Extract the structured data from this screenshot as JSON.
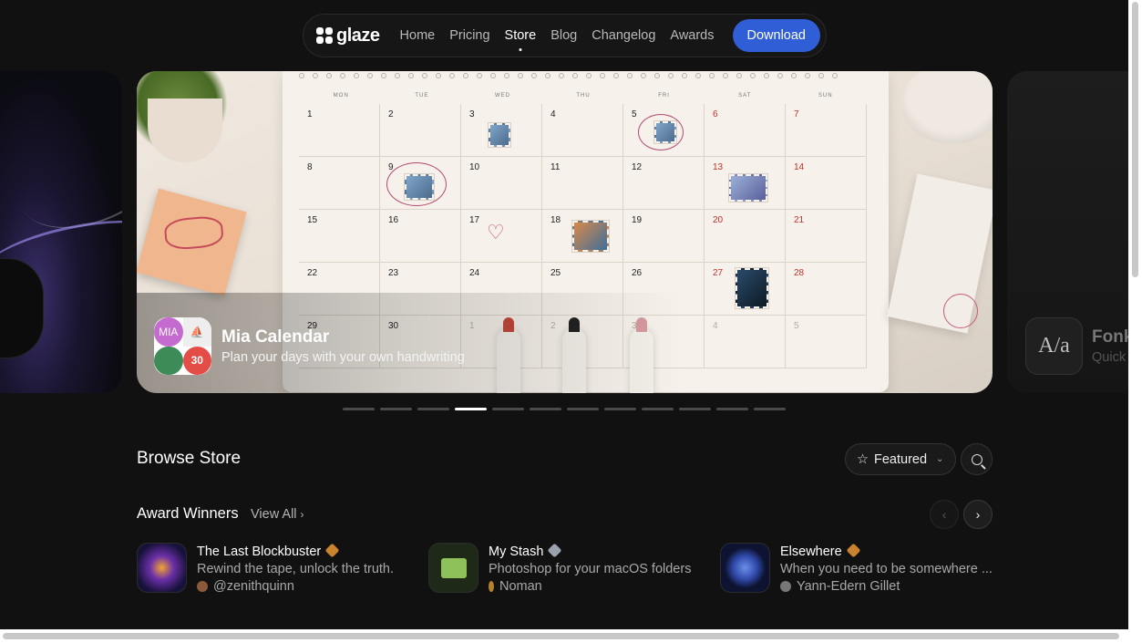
{
  "nav": {
    "logo_text": "glaze",
    "links": [
      "Home",
      "Pricing",
      "Store",
      "Blog",
      "Changelog",
      "Awards"
    ],
    "active_link": "Store",
    "download_label": "Download"
  },
  "carousel": {
    "main": {
      "app_name": "Mia Calendar",
      "tagline": "Plan your days with your own handwriting",
      "icon_labels": [
        "MIA",
        "30"
      ],
      "calendar": {
        "weekdays": [
          "MON",
          "TUE",
          "WED",
          "THU",
          "FRI",
          "SAT",
          "SUN"
        ],
        "days": [
          "1",
          "2",
          "3",
          "4",
          "5",
          "6",
          "7",
          "8",
          "9",
          "10",
          "11",
          "12",
          "13",
          "14",
          "15",
          "16",
          "17",
          "18",
          "19",
          "20",
          "21",
          "22",
          "23",
          "24",
          "25",
          "26",
          "27",
          "28",
          "29",
          "30",
          "1",
          "2",
          "3",
          "4",
          "5"
        ]
      }
    },
    "next": {
      "app_name": "Fonk",
      "tagline": "Quick",
      "icon_glyph": "A/a"
    },
    "dot_count": 12,
    "active_dot": 3
  },
  "browse": {
    "title": "Browse Store",
    "sort_label": "Featured"
  },
  "award_winners": {
    "title": "Award Winners",
    "view_all": "View All",
    "items": [
      {
        "title": "The Last Blockbuster",
        "description": "Rewind the tape, unlock the truth.",
        "author": "@zenithquinn",
        "badge_color": "#c9832f"
      },
      {
        "title": "My Stash",
        "description": "Photoshop for your macOS folders",
        "author": "Noman",
        "badge_color": "#9aa3ad"
      },
      {
        "title": "Elsewhere",
        "description": "When you need to be somewhere ...",
        "author": "Yann-Edern Gillet",
        "badge_color": "#c9832f"
      }
    ]
  },
  "colors": {
    "accent": "#2f5ed6",
    "background": "#111111"
  }
}
